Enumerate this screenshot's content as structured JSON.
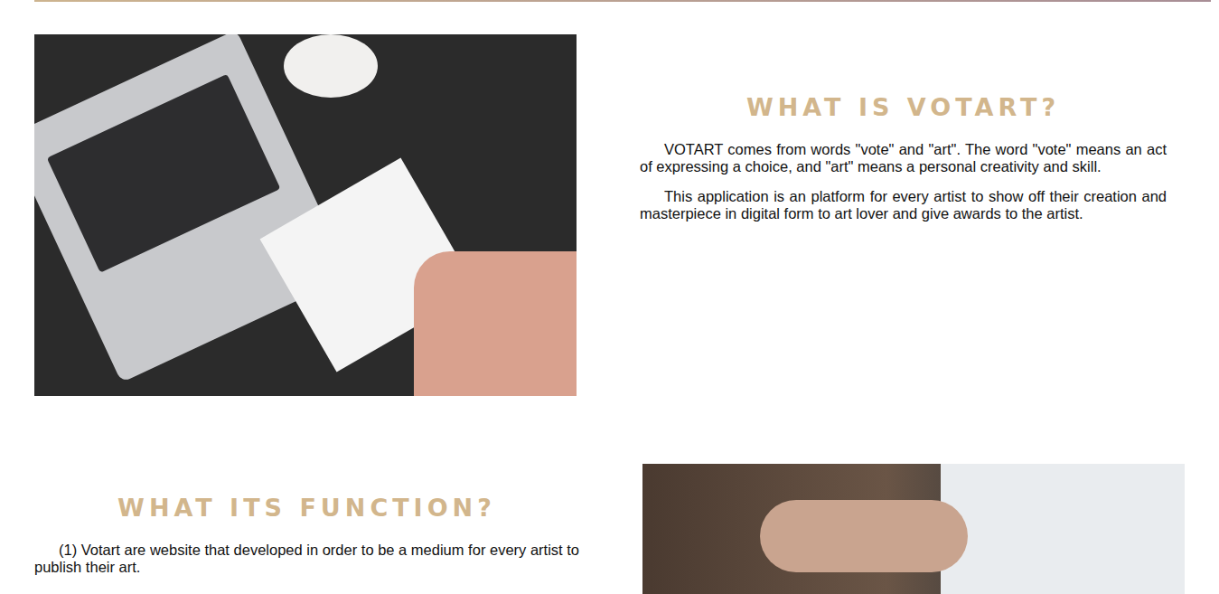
{
  "sections": [
    {
      "heading": "WHAT IS VOTART?",
      "paragraphs": [
        "VOTART comes from words \"vote\" and \"art\". The word \"vote\" means an act of expressing a choice, and \"art\" means a personal creativity and skill.",
        "This application is an platform for every artist to show off their creation and masterpiece in digital form to art lover and give awards to the artist."
      ]
    },
    {
      "heading": "WHAT ITS FUNCTION?",
      "paragraphs": [
        "(1) Votart are website that developed in order to be a medium for every artist to publish their art."
      ]
    }
  ]
}
